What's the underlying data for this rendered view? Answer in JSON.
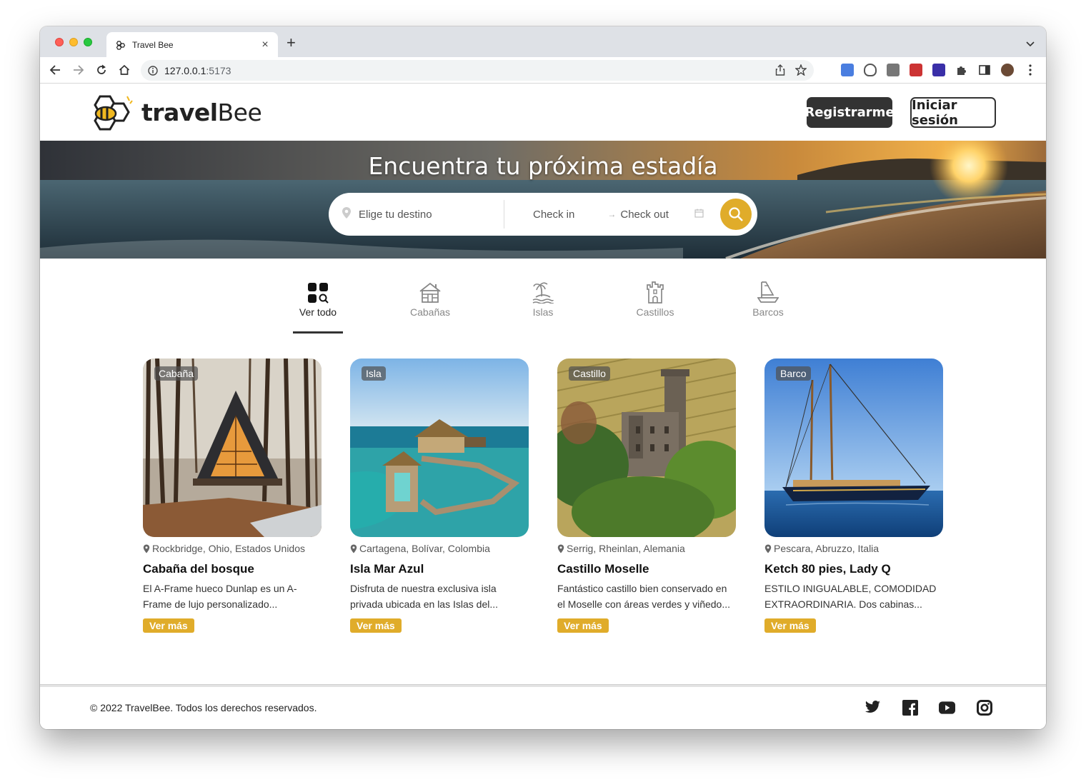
{
  "browser": {
    "tab_title": "Travel Bee",
    "url_host": "127.0.0.1",
    "url_port": ":5173",
    "new_tab_symbol": "+",
    "close_symbol": "×"
  },
  "header": {
    "logo_bold": "travel",
    "logo_light": "Bee",
    "register_label": "Registrarme",
    "login_label": "Iniciar sesión"
  },
  "hero": {
    "title": "Encuentra tu próxima estadía",
    "destination_placeholder": "Elige tu destino",
    "checkin_label": "Check in",
    "checkout_label": "Check out"
  },
  "categories": [
    {
      "label": "Ver todo",
      "icon": "grid-search-icon",
      "active": true
    },
    {
      "label": "Cabañas",
      "icon": "cabin-icon",
      "active": false
    },
    {
      "label": "Islas",
      "icon": "island-icon",
      "active": false
    },
    {
      "label": "Castillos",
      "icon": "castle-icon",
      "active": false
    },
    {
      "label": "Barcos",
      "icon": "boat-icon",
      "active": false
    }
  ],
  "listings": [
    {
      "badge": "Cabaña",
      "location": "Rockbridge, Ohio, Estados Unidos",
      "name": "Cabaña del bosque",
      "desc_line1": "El A-Frame hueco Dunlap es un A-",
      "desc_line2": "Frame de lujo personalizado...",
      "cta": "Ver más"
    },
    {
      "badge": "Isla",
      "location": "Cartagena, Bolívar, Colombia",
      "name": "Isla Mar Azul",
      "desc_line1": "Disfruta de nuestra exclusiva isla",
      "desc_line2": "privada ubicada en las Islas del...",
      "cta": "Ver más"
    },
    {
      "badge": "Castillo",
      "location": "Serrig, Rheinlan, Alemania",
      "name": "Castillo Moselle",
      "desc_line1": "Fantástico castillo bien conservado en",
      "desc_line2": "el Moselle con áreas verdes y viñedo...",
      "cta": "Ver más"
    },
    {
      "badge": "Barco",
      "location": "Pescara, Abruzzo, Italia",
      "name": "Ketch 80 pies, Lady Q",
      "desc_line1": "ESTILO INIGUALABLE, COMODIDAD",
      "desc_line2": "EXTRAORDINARIA. Dos cabinas...",
      "cta": "Ver más"
    }
  ],
  "footer": {
    "copyright": "© 2022 TravelBee. Todos los derechos reservados.",
    "socials": [
      "twitter-icon",
      "facebook-icon",
      "youtube-icon",
      "instagram-icon"
    ]
  },
  "colors": {
    "accent": "#e0ac2a",
    "dark": "#333333"
  }
}
